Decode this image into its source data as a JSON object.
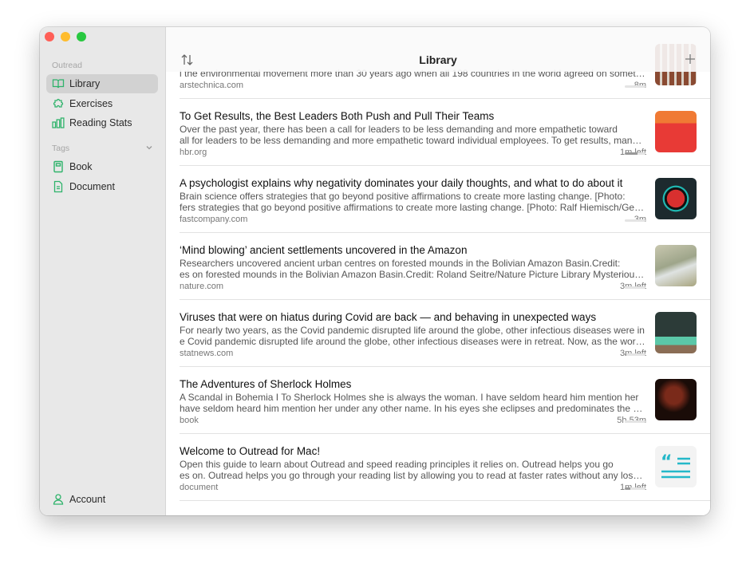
{
  "window": {
    "title": "Library"
  },
  "colors": {
    "accent": "#2fb36b",
    "close": "#ff5f57",
    "minimize": "#febc2e",
    "zoom": "#28c840"
  },
  "sidebar": {
    "section_app": "Outread",
    "items": [
      {
        "label": "Library",
        "icon": "book-open-icon",
        "active": true
      },
      {
        "label": "Exercises",
        "icon": "puzzle-icon"
      },
      {
        "label": "Reading Stats",
        "icon": "bar-chart-icon"
      }
    ],
    "section_tags": "Tags",
    "tags": [
      {
        "label": "Book",
        "icon": "book-icon"
      },
      {
        "label": "Document",
        "icon": "document-icon"
      }
    ],
    "account": "Account"
  },
  "articles": [
    {
      "title": "",
      "line1": "",
      "line2": "l the environmental movement more than 30 years ago when all 198 countries in the world agreed on somethin...",
      "source": "arstechnica.com",
      "time": "8m",
      "progress": 0,
      "thumb": "brick-building"
    },
    {
      "title": "To Get Results, the Best Leaders Both Push and Pull Their Teams",
      "line1": " Over the past year, there has been a call for leaders to be less demanding and more empathetic toward",
      "line2": "all for leaders to be less demanding and more empathetic toward individual employees. To get results, manager...",
      "source": "hbr.org",
      "time": "1m left",
      "progress": 60,
      "thumb": "red-orange-illustration"
    },
    {
      "title": "A psychologist explains why negativity dominates your daily thoughts, and what to do about it",
      "line1": "Brain science offers strategies that go beyond positive affirmations to create more lasting change.  [Photo:",
      "line2": "fers strategies that go beyond positive affirmations to create more lasting change.  [Photo: Ralf Hiemisch/Getty...",
      "source": "fastcompany.com",
      "time": "3m",
      "progress": 0,
      "thumb": "red-circle"
    },
    {
      "title": "‘Mind blowing’ ancient settlements uncovered in the Amazon",
      "line1": " Researchers uncovered ancient urban centres on forested mounds in the Bolivian Amazon Basin.Credit:",
      "line2": "es on forested mounds in the Bolivian Amazon Basin.Credit: Roland Seitre/Nature Picture Library Mysterious mo...",
      "source": "nature.com",
      "time": "3m left",
      "progress": 0,
      "thumb": "aerial-landscape"
    },
    {
      "title": "Viruses that were on hiatus during Covid are back — and behaving in unexpected ways",
      "line1": " For nearly two years, as the Covid pandemic disrupted life around the globe, other infectious diseases were in",
      "line2": "e Covid pandemic disrupted life around the globe, other infectious diseases were in retreat. Now, as the world r...",
      "source": "statnews.com",
      "time": "3m left",
      "progress": 8,
      "thumb": "virus-masks"
    },
    {
      "title": "The Adventures of Sherlock Holmes",
      "line1": "A Scandal in Bohemia I To Sherlock Holmes she is always the woman. I have seldom heard him mention her",
      "line2": "have seldom heard him mention her under any other name. In his eyes she eclipses and predominates the whol...",
      "source": "book",
      "time": "5h 53m",
      "progress": 0,
      "thumb": "violinist-portrait"
    },
    {
      "title": "Welcome to Outread for Mac!",
      "line1": "Open this guide to learn about Outread and speed reading principles it relies on. Outread helps you go",
      "line2": "es on. Outread helps you go through your reading list by allowing you to read at faster rates without any loss in...",
      "source": "document",
      "time": "1m left",
      "progress": 25,
      "thumb": "quote-icon"
    }
  ]
}
